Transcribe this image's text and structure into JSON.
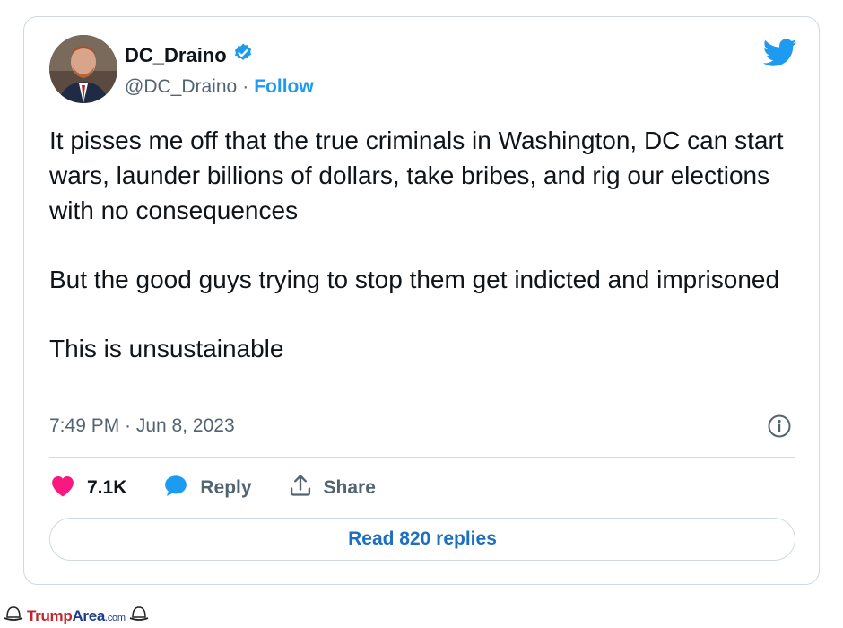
{
  "tweet": {
    "display_name": "DC_Draino",
    "handle": "@DC_Draino",
    "separator": "·",
    "follow_label": "Follow",
    "paragraphs": [
      "It pisses me off that the true criminals in Washington, DC can start wars, launder billions of dollars, take bribes, and rig our elections with no consequences",
      "But the good guys trying to stop them get indicted and imprisoned",
      "This is unsustainable"
    ],
    "timestamp": "7:49 PM · Jun 8, 2023",
    "like_count": "7.1K",
    "reply_label": "Reply",
    "share_label": "Share",
    "read_replies_label": "Read 820 replies"
  },
  "watermark": {
    "brand_part1": "Trump",
    "brand_part2": "Area",
    "brand_suffix": ".com"
  },
  "icons": {
    "verified": "verified-badge-icon",
    "bird": "twitter-bird-icon",
    "info": "info-icon",
    "like": "heart-icon",
    "reply": "reply-bubble-icon",
    "share": "share-upload-icon"
  },
  "colors": {
    "accent": "#1d9bf0",
    "like": "#f91880",
    "text_primary": "#0f1419",
    "text_secondary": "#536471",
    "border": "#cfd9de"
  }
}
